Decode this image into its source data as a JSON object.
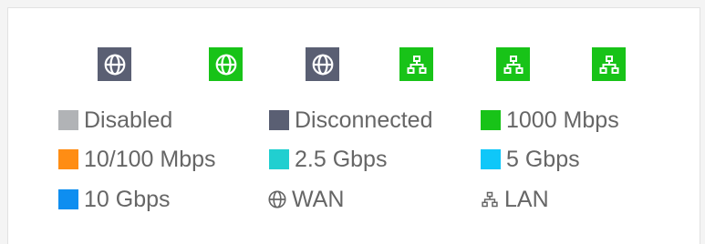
{
  "ports": [
    {
      "type": "WAN",
      "status": "Disconnected",
      "icon": "globe-icon"
    },
    {
      "type": "WAN",
      "status": "1000 Mbps",
      "icon": "globe-icon"
    },
    {
      "type": "WAN",
      "status": "Disconnected",
      "icon": "globe-icon"
    },
    {
      "type": "LAN",
      "status": "1000 Mbps",
      "icon": "network-icon"
    },
    {
      "type": "LAN",
      "status": "1000 Mbps",
      "icon": "network-icon"
    },
    {
      "type": "LAN",
      "status": "1000 Mbps",
      "icon": "network-icon"
    }
  ],
  "legend": {
    "disabled": {
      "label": "Disabled",
      "color": "#b1b3b6"
    },
    "disconnected": {
      "label": "Disconnected",
      "color": "#5a5f73"
    },
    "mbps1000": {
      "label": "1000 Mbps",
      "color": "#18c318"
    },
    "mbps10_100": {
      "label": "10/100 Mbps",
      "color": "#ff8d14"
    },
    "gbps2_5": {
      "label": "2.5 Gbps",
      "color": "#21cfd0"
    },
    "gbps5": {
      "label": "5 Gbps",
      "color": "#0fc7f9"
    },
    "gbps10": {
      "label": "10 Gbps",
      "color": "#0e8ef0"
    },
    "wan": {
      "label": "WAN",
      "icon": "globe-icon"
    },
    "lan": {
      "label": "LAN",
      "icon": "network-icon"
    }
  }
}
